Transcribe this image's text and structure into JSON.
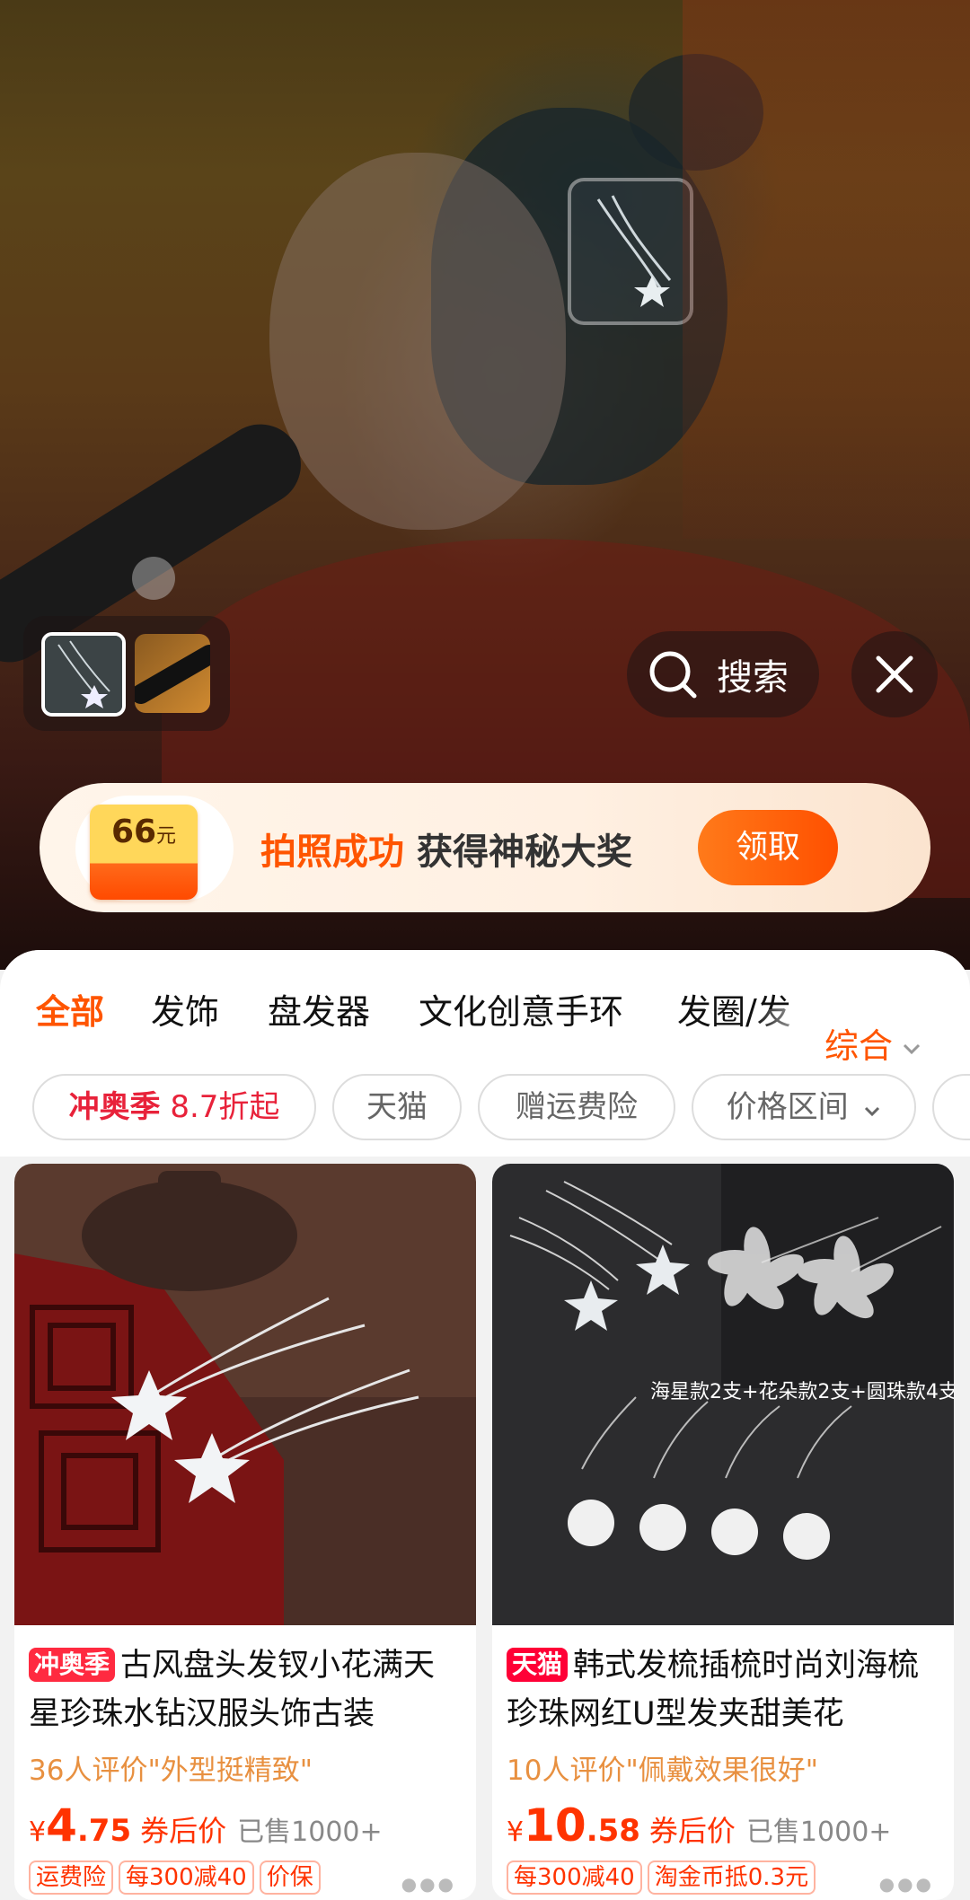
{
  "camera": {
    "search_label": "搜索"
  },
  "promo": {
    "coupon_amount": "66",
    "coupon_unit": "元",
    "highlight": "拍照成功",
    "text": "获得神秘大奖",
    "claim_label": "领取"
  },
  "tabs": [
    "全部",
    "发饰",
    "盘发器",
    "文化创意手环",
    "发圈/发"
  ],
  "sort_label": "综合",
  "chips": {
    "hot_prefix": "冲奥季",
    "hot_suffix": "8.7折起",
    "items": [
      "天猫",
      "赠运费险",
      "价格区间"
    ]
  },
  "products": [
    {
      "badge": "冲奥季",
      "title": "古风盘头发钗小花满天星珍珠水钻汉服头饰古装",
      "review": "36人评价\"外型挺精致\"",
      "currency": "¥",
      "price_int": "4",
      "price_dec": ".75",
      "price_note": "券后价",
      "sold": "已售1000+",
      "tags": [
        "运费险",
        "每300减40",
        "价保"
      ]
    },
    {
      "badge": "天猫",
      "title": "韩式发梳插梳时尚刘海梳珍珠网红U型发夹甜美花",
      "review": "10人评价\"佩戴效果很好\"",
      "currency": "¥",
      "price_int": "10",
      "price_dec": ".58",
      "price_note": "券后价",
      "sold": "已售1000+",
      "tags": [
        "每300减40",
        "淘金币抵0.3元"
      ],
      "image_caption": "海星款2支+花朵款2支+圆珠款4支"
    }
  ],
  "colors": {
    "accent": "#ff5500",
    "price": "#ff3300",
    "tmall_red": "#ff0036"
  }
}
